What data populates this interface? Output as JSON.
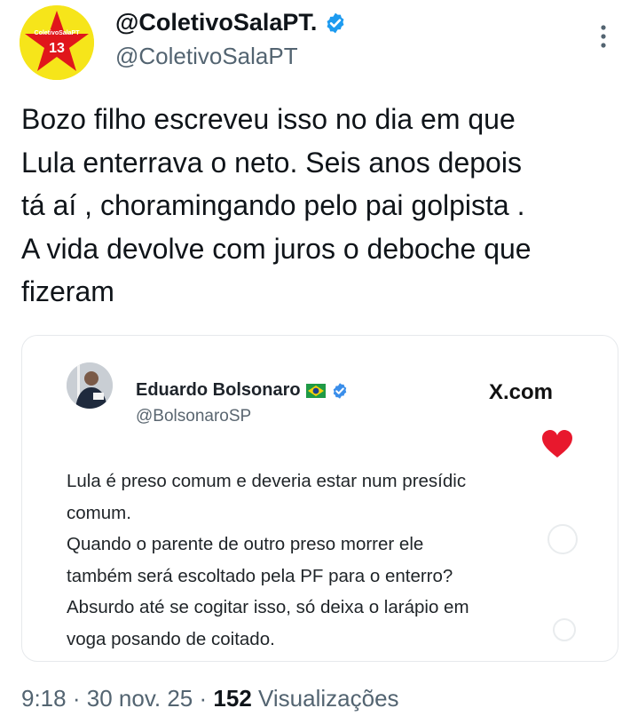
{
  "author": {
    "display_name": "@ColetivoSalaPT.",
    "handle": "@ColetivoSalaPT",
    "avatar_text": "ColetivoSalaPT",
    "avatar_number": "13",
    "accent": "#1d9bf0"
  },
  "tweet": {
    "text": "Bozo filho escreveu isso no dia em que\nLula enterrava o neto. Seis anos depois\ntá aí , choramingando pelo pai golpista .\nA vida devolve com juros o deboche que\nfizeram"
  },
  "embedded": {
    "name": "Eduardo Bolsonaro",
    "handle": "@BolsonaroSP",
    "source": "X.com",
    "text": "Lula é preso comum e deveria estar num presídic\ncomum.\nQuando o parente de outro preso morrer ele\ntambém será escoltado pela PF para o enterro?\nAbsurdo até se cogitar isso, só deixa o larápio em\nvoga posando de coitado."
  },
  "meta": {
    "time": "9:18",
    "date": "30 nov. 25",
    "views_count": "152",
    "views_label": "Visualizações",
    "separator": "·"
  }
}
